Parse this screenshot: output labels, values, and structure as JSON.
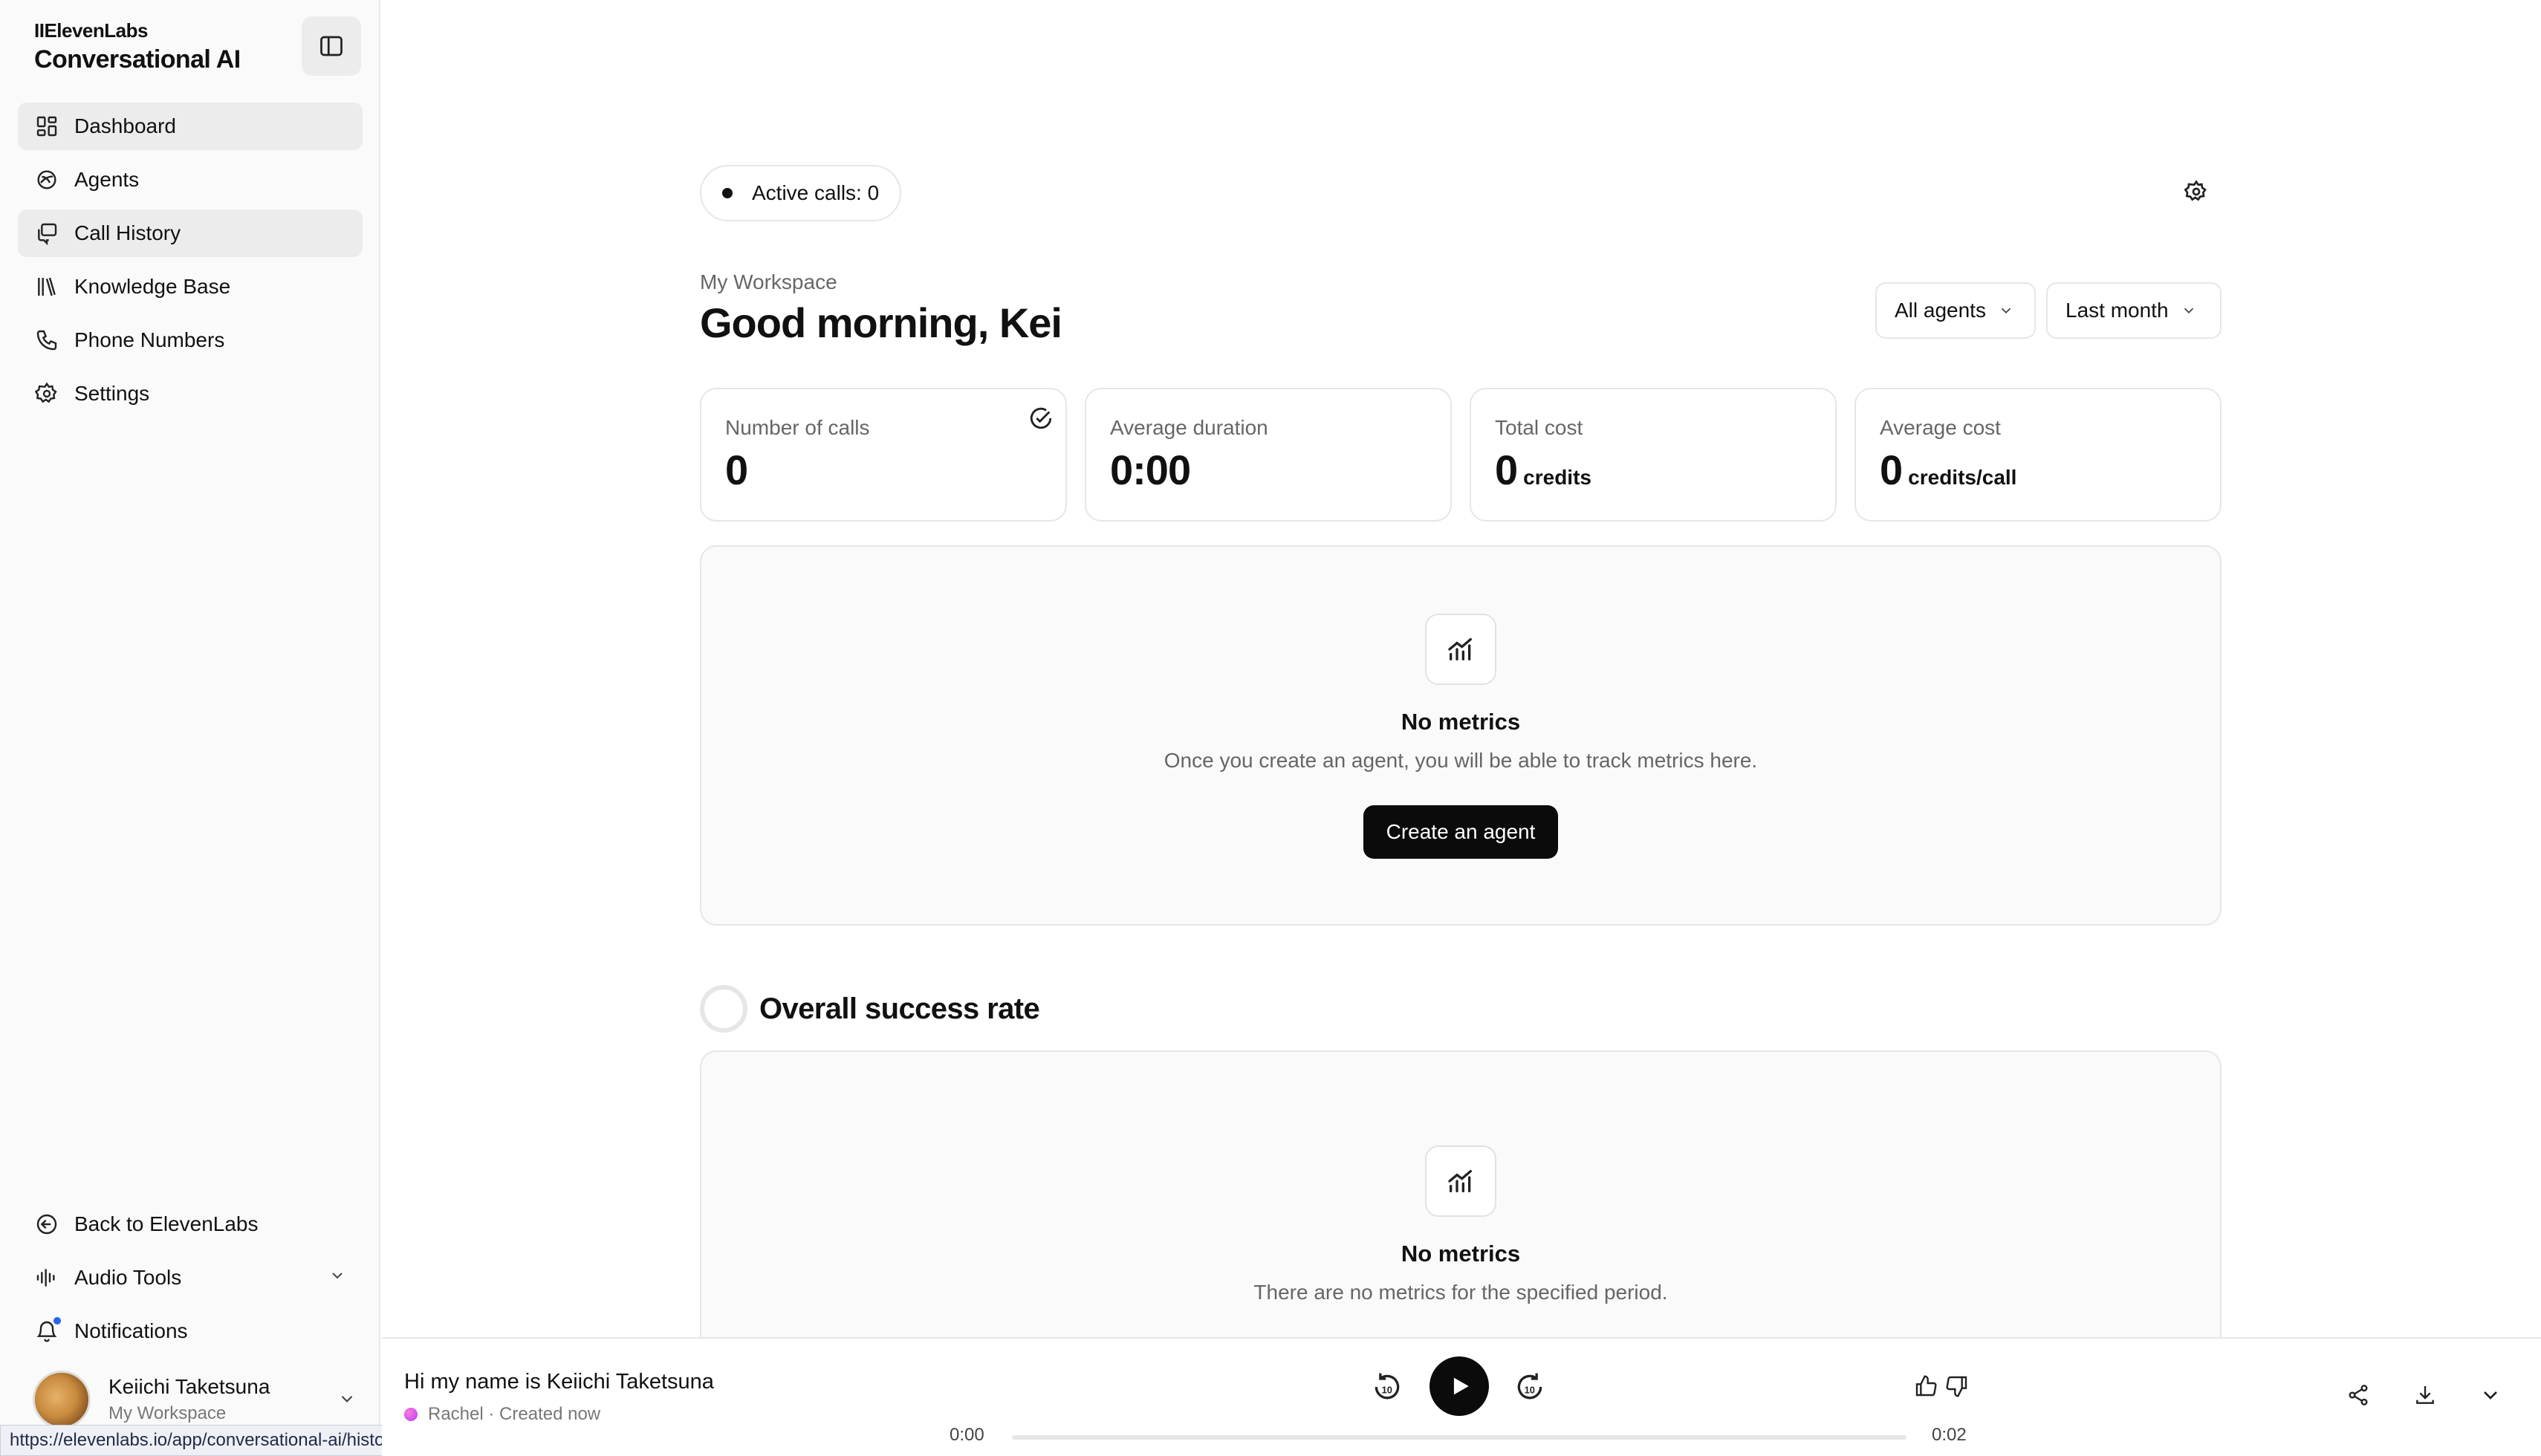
{
  "sidebar": {
    "brand_small": "IIElevenLabs",
    "brand_title": "Conversational AI",
    "nav": [
      {
        "label": "Dashboard",
        "icon": "dashboard-icon",
        "active": true
      },
      {
        "label": "Agents",
        "icon": "agents-icon",
        "active": false
      },
      {
        "label": "Call History",
        "icon": "call-history-icon",
        "active": false,
        "hovered": true
      },
      {
        "label": "Knowledge Base",
        "icon": "knowledge-base-icon",
        "active": false
      },
      {
        "label": "Phone Numbers",
        "icon": "phone-icon",
        "active": false
      },
      {
        "label": "Settings",
        "icon": "settings-icon",
        "active": false
      }
    ],
    "bottom": {
      "back_label": "Back to ElevenLabs",
      "audio_tools_label": "Audio Tools",
      "notifications_label": "Notifications"
    },
    "user": {
      "name": "Keiichi Taketsuna",
      "workspace": "My Workspace"
    }
  },
  "status_url": "https://elevenlabs.io/app/conversational-ai/history",
  "header": {
    "active_calls": "Active calls: 0",
    "workspace": "My Workspace",
    "greeting": "Good morning, Kei",
    "filter_agents": "All agents",
    "filter_period": "Last month"
  },
  "stats": [
    {
      "label": "Number of calls",
      "value": "0",
      "unit": ""
    },
    {
      "label": "Average duration",
      "value": "0:00",
      "unit": ""
    },
    {
      "label": "Total cost",
      "value": "0",
      "unit": "credits"
    },
    {
      "label": "Average cost",
      "value": "0",
      "unit": "credits/call"
    }
  ],
  "metrics_panel": {
    "title": "No metrics",
    "text": "Once you create an agent, you will be able to track metrics here.",
    "button": "Create an agent"
  },
  "success_section": {
    "title": "Overall success rate",
    "empty_title": "No metrics",
    "empty_text": "There are no metrics for the specified period."
  },
  "player": {
    "title": "Hi my name is Keiichi Taketsuna",
    "voice": "Rachel",
    "created": "Created now",
    "time_current": "0:00",
    "time_total": "0:02",
    "progress_fraction": 0,
    "skip_seconds": "10"
  },
  "colors": {
    "accent": "#0b0b0b",
    "notification_dot": "#2563eb"
  }
}
